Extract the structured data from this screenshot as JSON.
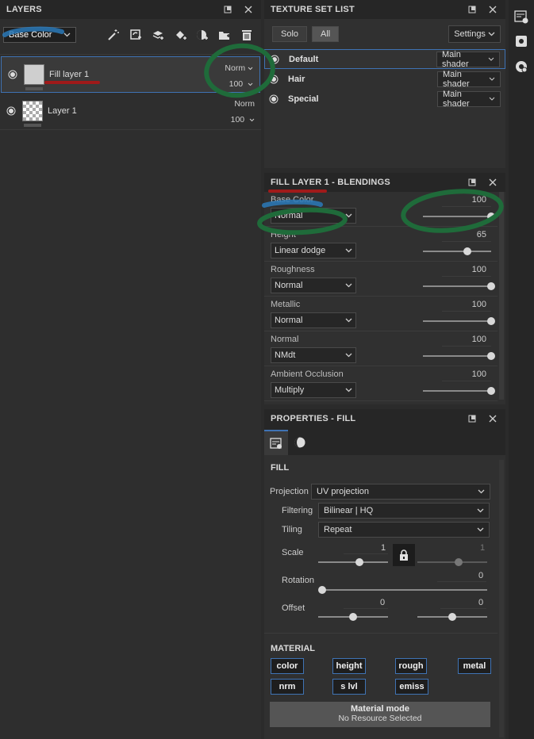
{
  "layers": {
    "title": "LAYERS",
    "channel": "Base Color",
    "items": [
      {
        "name": "Fill layer 1",
        "blend": "Norm",
        "opacity": "100"
      },
      {
        "name": "Layer 1",
        "blend": "Norm",
        "opacity": "100"
      }
    ]
  },
  "texture_set_list": {
    "title": "TEXTURE SET LIST",
    "solo": "Solo",
    "all": "All",
    "settings": "Settings",
    "sets": [
      {
        "name": "Default",
        "shader": "Main shader"
      },
      {
        "name": "Hair",
        "shader": "Main shader"
      },
      {
        "name": "Special",
        "shader": "Main shader"
      }
    ]
  },
  "blendings": {
    "title": "FILL LAYER 1 - BLENDINGS",
    "channels": [
      {
        "name": "Base Color",
        "mode": "Normal",
        "value": "100",
        "fraction": 1.0
      },
      {
        "name": "Height",
        "mode": "Linear dodge",
        "value": "65",
        "fraction": 0.65
      },
      {
        "name": "Roughness",
        "mode": "Normal",
        "value": "100",
        "fraction": 1.0
      },
      {
        "name": "Metallic",
        "mode": "Normal",
        "value": "100",
        "fraction": 1.0
      },
      {
        "name": "Normal",
        "mode": "NMdt",
        "value": "100",
        "fraction": 1.0
      },
      {
        "name": "Ambient Occlusion",
        "mode": "Multiply",
        "value": "100",
        "fraction": 1.0
      }
    ]
  },
  "properties": {
    "title": "PROPERTIES - FILL",
    "fill_section": "FILL",
    "projection_label": "Projection",
    "projection_value": "UV projection",
    "filtering_label": "Filtering",
    "filtering_value": "Bilinear | HQ",
    "tiling_label": "Tiling",
    "tiling_value": "Repeat",
    "scale_label": "Scale",
    "scale_value": "1",
    "scale_value2": "1",
    "rotation_label": "Rotation",
    "rotation_value": "0",
    "offset_label": "Offset",
    "offset_x": "0",
    "offset_y": "0",
    "material_section": "MATERIAL",
    "material_chips": [
      "color",
      "height",
      "rough",
      "metal",
      "nrm",
      "s lvl",
      "emiss"
    ],
    "material_mode": "Material mode",
    "material_resource": "No Resource Selected"
  },
  "colors": {
    "accent": "#3f73b4",
    "annotation_green": "#1f6b3a",
    "annotation_red": "#a01a1a",
    "annotation_blue": "#2a79b8"
  }
}
